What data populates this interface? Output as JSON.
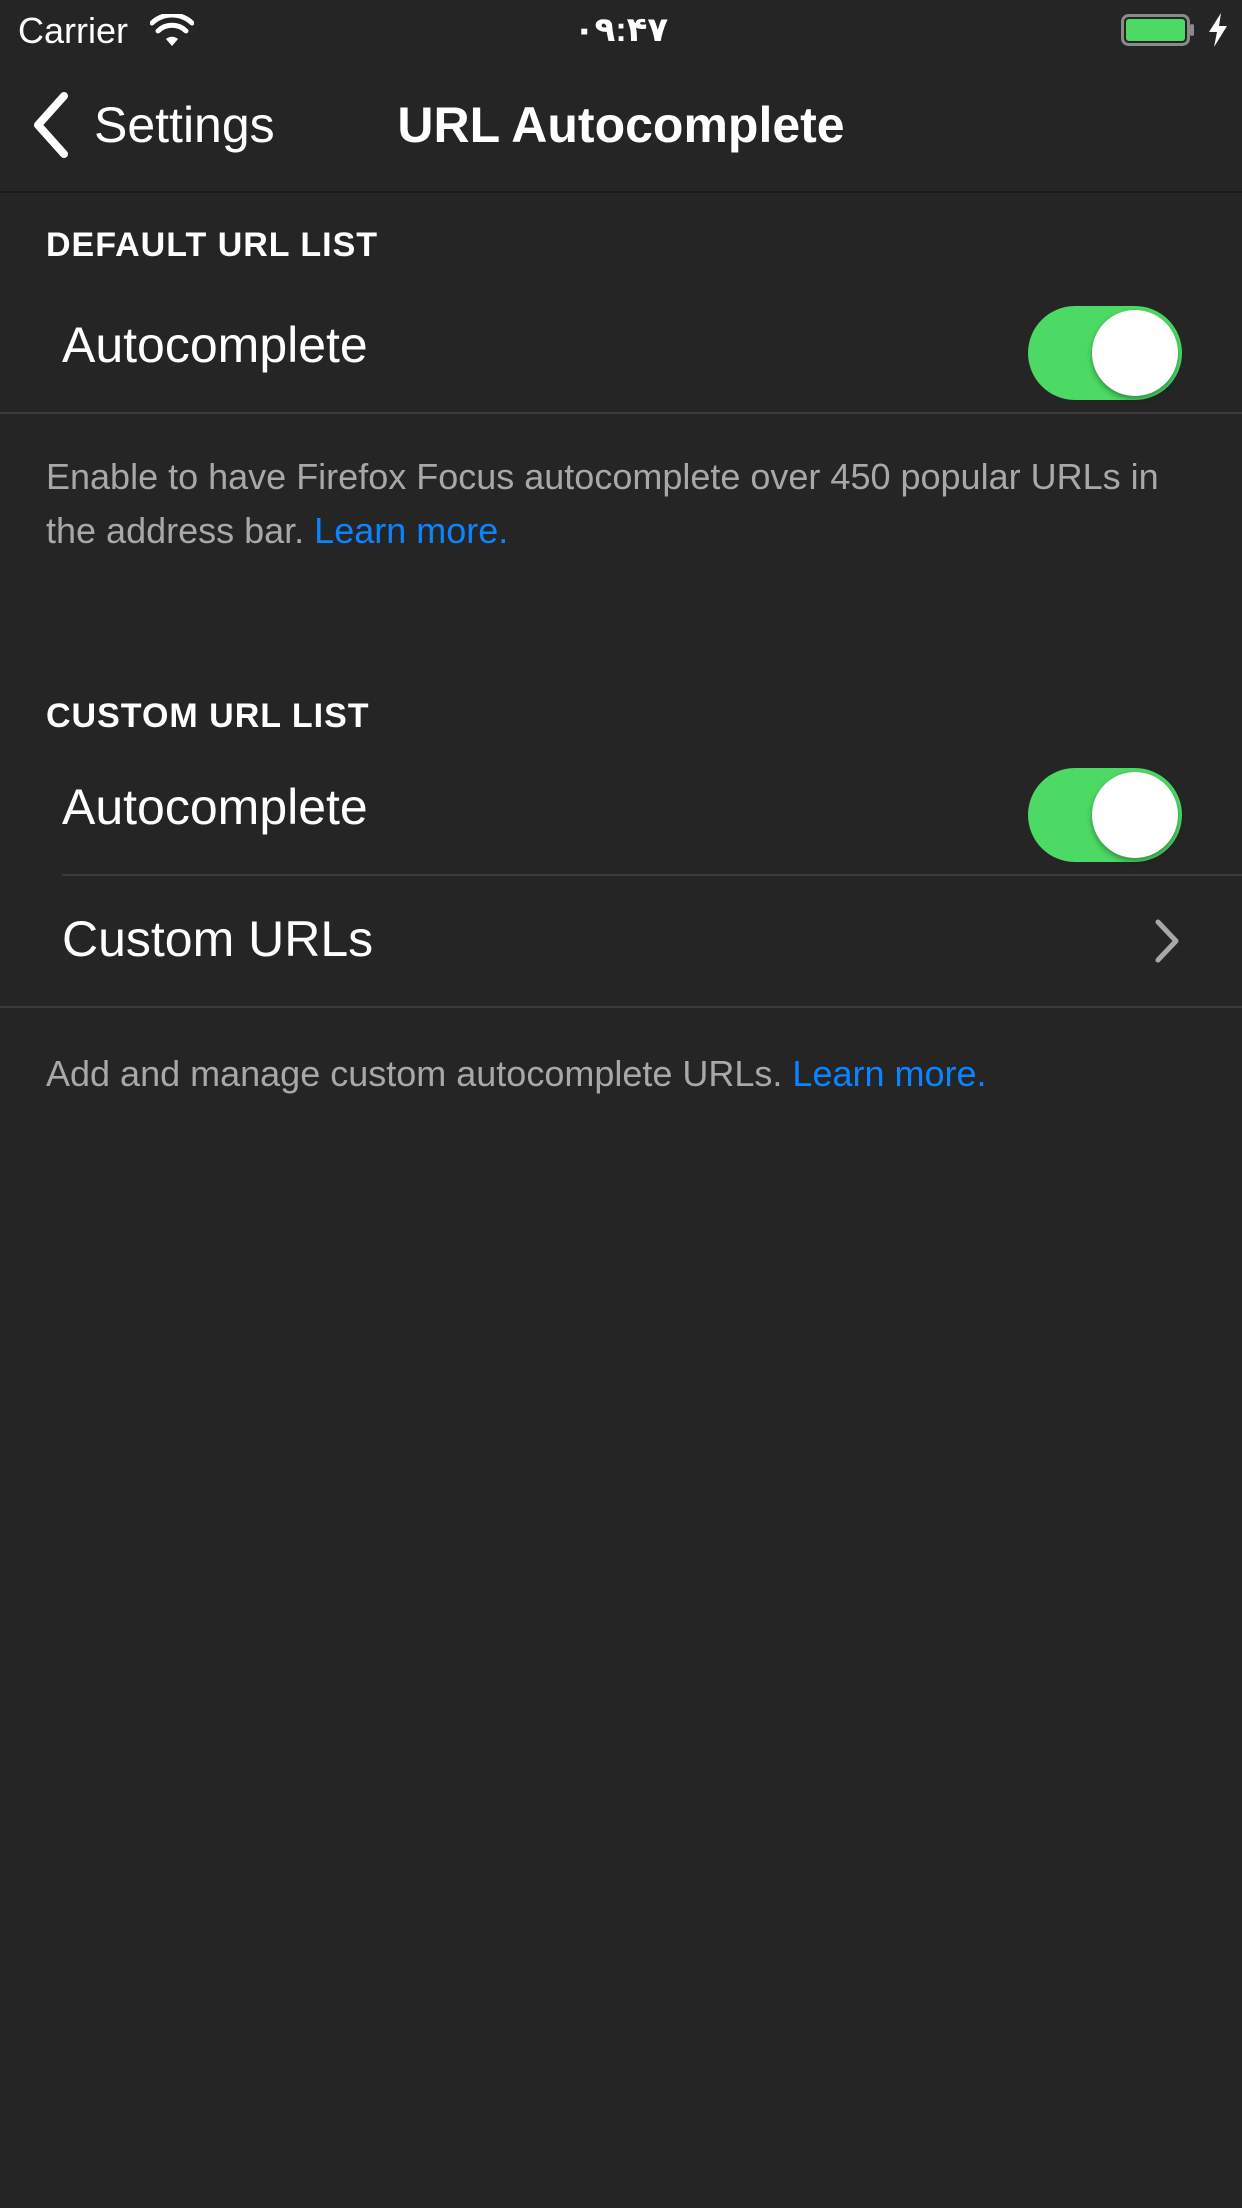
{
  "status_bar": {
    "carrier": "Carrier",
    "time": "۰۹:۴۷",
    "battery_color": "#4cd964"
  },
  "nav": {
    "back_label": "Settings",
    "title": "URL Autocomplete"
  },
  "default_section": {
    "header": "DEFAULT URL LIST",
    "autocomplete_label": "Autocomplete",
    "autocomplete_on": true,
    "footer_text": "Enable to have Firefox Focus autocomplete over 450 popular URLs in the address bar. ",
    "footer_link": "Learn more."
  },
  "custom_section": {
    "header": "CUSTOM URL LIST",
    "autocomplete_label": "Autocomplete",
    "autocomplete_on": true,
    "custom_urls_label": "Custom URLs",
    "footer_text": "Add and manage custom autocomplete URLs. ",
    "footer_link": "Learn more."
  },
  "colors": {
    "background": "#252525",
    "toggle_on": "#4cd964",
    "link": "#0a84ff"
  }
}
